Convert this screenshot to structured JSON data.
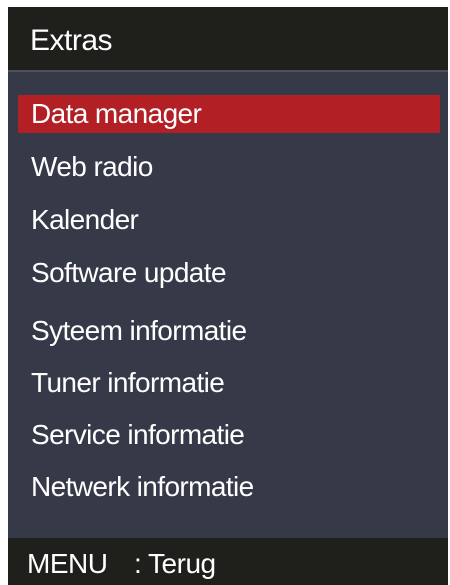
{
  "window": {
    "title": "Extras"
  },
  "menu": {
    "selected_index": 0,
    "items": [
      {
        "label": "Data manager"
      },
      {
        "label": "Web radio"
      },
      {
        "label": "Kalender"
      },
      {
        "label": "Software update"
      },
      {
        "label": "Syteem informatie"
      },
      {
        "label": "Tuner informatie"
      },
      {
        "label": "Service informatie"
      },
      {
        "label": "Netwerk informatie"
      }
    ]
  },
  "footer": {
    "key_label": "MENU",
    "action_label": ": Terug"
  },
  "colors": {
    "background": "#363a48",
    "bars": "#1f1f1c",
    "selection": "#b21f24",
    "text": "#ffffff"
  }
}
